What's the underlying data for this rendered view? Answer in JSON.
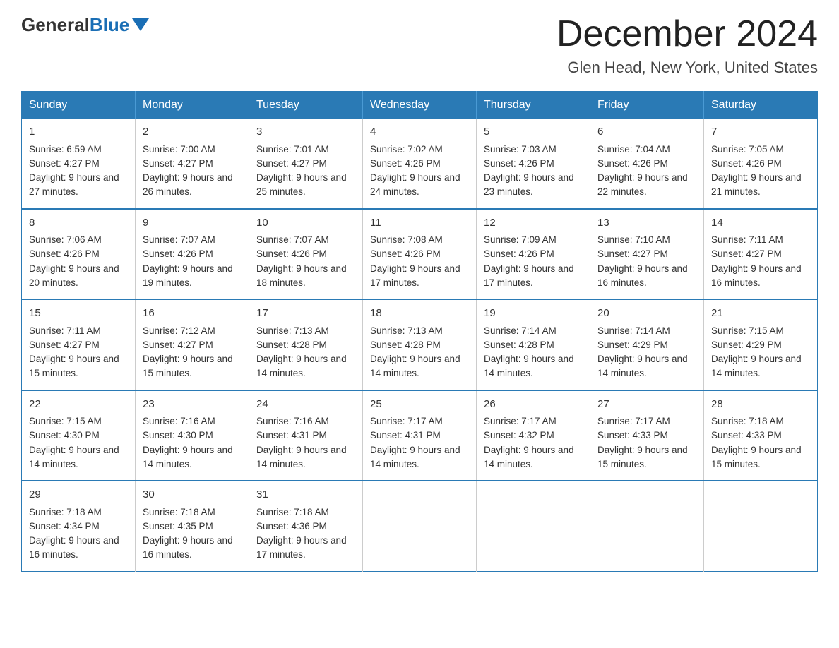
{
  "logo": {
    "general": "General",
    "blue": "Blue"
  },
  "title": "December 2024",
  "subtitle": "Glen Head, New York, United States",
  "weekdays": [
    "Sunday",
    "Monday",
    "Tuesday",
    "Wednesday",
    "Thursday",
    "Friday",
    "Saturday"
  ],
  "weeks": [
    [
      {
        "day": "1",
        "sunrise": "Sunrise: 6:59 AM",
        "sunset": "Sunset: 4:27 PM",
        "daylight": "Daylight: 9 hours and 27 minutes."
      },
      {
        "day": "2",
        "sunrise": "Sunrise: 7:00 AM",
        "sunset": "Sunset: 4:27 PM",
        "daylight": "Daylight: 9 hours and 26 minutes."
      },
      {
        "day": "3",
        "sunrise": "Sunrise: 7:01 AM",
        "sunset": "Sunset: 4:27 PM",
        "daylight": "Daylight: 9 hours and 25 minutes."
      },
      {
        "day": "4",
        "sunrise": "Sunrise: 7:02 AM",
        "sunset": "Sunset: 4:26 PM",
        "daylight": "Daylight: 9 hours and 24 minutes."
      },
      {
        "day": "5",
        "sunrise": "Sunrise: 7:03 AM",
        "sunset": "Sunset: 4:26 PM",
        "daylight": "Daylight: 9 hours and 23 minutes."
      },
      {
        "day": "6",
        "sunrise": "Sunrise: 7:04 AM",
        "sunset": "Sunset: 4:26 PM",
        "daylight": "Daylight: 9 hours and 22 minutes."
      },
      {
        "day": "7",
        "sunrise": "Sunrise: 7:05 AM",
        "sunset": "Sunset: 4:26 PM",
        "daylight": "Daylight: 9 hours and 21 minutes."
      }
    ],
    [
      {
        "day": "8",
        "sunrise": "Sunrise: 7:06 AM",
        "sunset": "Sunset: 4:26 PM",
        "daylight": "Daylight: 9 hours and 20 minutes."
      },
      {
        "day": "9",
        "sunrise": "Sunrise: 7:07 AM",
        "sunset": "Sunset: 4:26 PM",
        "daylight": "Daylight: 9 hours and 19 minutes."
      },
      {
        "day": "10",
        "sunrise": "Sunrise: 7:07 AM",
        "sunset": "Sunset: 4:26 PM",
        "daylight": "Daylight: 9 hours and 18 minutes."
      },
      {
        "day": "11",
        "sunrise": "Sunrise: 7:08 AM",
        "sunset": "Sunset: 4:26 PM",
        "daylight": "Daylight: 9 hours and 17 minutes."
      },
      {
        "day": "12",
        "sunrise": "Sunrise: 7:09 AM",
        "sunset": "Sunset: 4:26 PM",
        "daylight": "Daylight: 9 hours and 17 minutes."
      },
      {
        "day": "13",
        "sunrise": "Sunrise: 7:10 AM",
        "sunset": "Sunset: 4:27 PM",
        "daylight": "Daylight: 9 hours and 16 minutes."
      },
      {
        "day": "14",
        "sunrise": "Sunrise: 7:11 AM",
        "sunset": "Sunset: 4:27 PM",
        "daylight": "Daylight: 9 hours and 16 minutes."
      }
    ],
    [
      {
        "day": "15",
        "sunrise": "Sunrise: 7:11 AM",
        "sunset": "Sunset: 4:27 PM",
        "daylight": "Daylight: 9 hours and 15 minutes."
      },
      {
        "day": "16",
        "sunrise": "Sunrise: 7:12 AM",
        "sunset": "Sunset: 4:27 PM",
        "daylight": "Daylight: 9 hours and 15 minutes."
      },
      {
        "day": "17",
        "sunrise": "Sunrise: 7:13 AM",
        "sunset": "Sunset: 4:28 PM",
        "daylight": "Daylight: 9 hours and 14 minutes."
      },
      {
        "day": "18",
        "sunrise": "Sunrise: 7:13 AM",
        "sunset": "Sunset: 4:28 PM",
        "daylight": "Daylight: 9 hours and 14 minutes."
      },
      {
        "day": "19",
        "sunrise": "Sunrise: 7:14 AM",
        "sunset": "Sunset: 4:28 PM",
        "daylight": "Daylight: 9 hours and 14 minutes."
      },
      {
        "day": "20",
        "sunrise": "Sunrise: 7:14 AM",
        "sunset": "Sunset: 4:29 PM",
        "daylight": "Daylight: 9 hours and 14 minutes."
      },
      {
        "day": "21",
        "sunrise": "Sunrise: 7:15 AM",
        "sunset": "Sunset: 4:29 PM",
        "daylight": "Daylight: 9 hours and 14 minutes."
      }
    ],
    [
      {
        "day": "22",
        "sunrise": "Sunrise: 7:15 AM",
        "sunset": "Sunset: 4:30 PM",
        "daylight": "Daylight: 9 hours and 14 minutes."
      },
      {
        "day": "23",
        "sunrise": "Sunrise: 7:16 AM",
        "sunset": "Sunset: 4:30 PM",
        "daylight": "Daylight: 9 hours and 14 minutes."
      },
      {
        "day": "24",
        "sunrise": "Sunrise: 7:16 AM",
        "sunset": "Sunset: 4:31 PM",
        "daylight": "Daylight: 9 hours and 14 minutes."
      },
      {
        "day": "25",
        "sunrise": "Sunrise: 7:17 AM",
        "sunset": "Sunset: 4:31 PM",
        "daylight": "Daylight: 9 hours and 14 minutes."
      },
      {
        "day": "26",
        "sunrise": "Sunrise: 7:17 AM",
        "sunset": "Sunset: 4:32 PM",
        "daylight": "Daylight: 9 hours and 14 minutes."
      },
      {
        "day": "27",
        "sunrise": "Sunrise: 7:17 AM",
        "sunset": "Sunset: 4:33 PM",
        "daylight": "Daylight: 9 hours and 15 minutes."
      },
      {
        "day": "28",
        "sunrise": "Sunrise: 7:18 AM",
        "sunset": "Sunset: 4:33 PM",
        "daylight": "Daylight: 9 hours and 15 minutes."
      }
    ],
    [
      {
        "day": "29",
        "sunrise": "Sunrise: 7:18 AM",
        "sunset": "Sunset: 4:34 PM",
        "daylight": "Daylight: 9 hours and 16 minutes."
      },
      {
        "day": "30",
        "sunrise": "Sunrise: 7:18 AM",
        "sunset": "Sunset: 4:35 PM",
        "daylight": "Daylight: 9 hours and 16 minutes."
      },
      {
        "day": "31",
        "sunrise": "Sunrise: 7:18 AM",
        "sunset": "Sunset: 4:36 PM",
        "daylight": "Daylight: 9 hours and 17 minutes."
      },
      null,
      null,
      null,
      null
    ]
  ]
}
